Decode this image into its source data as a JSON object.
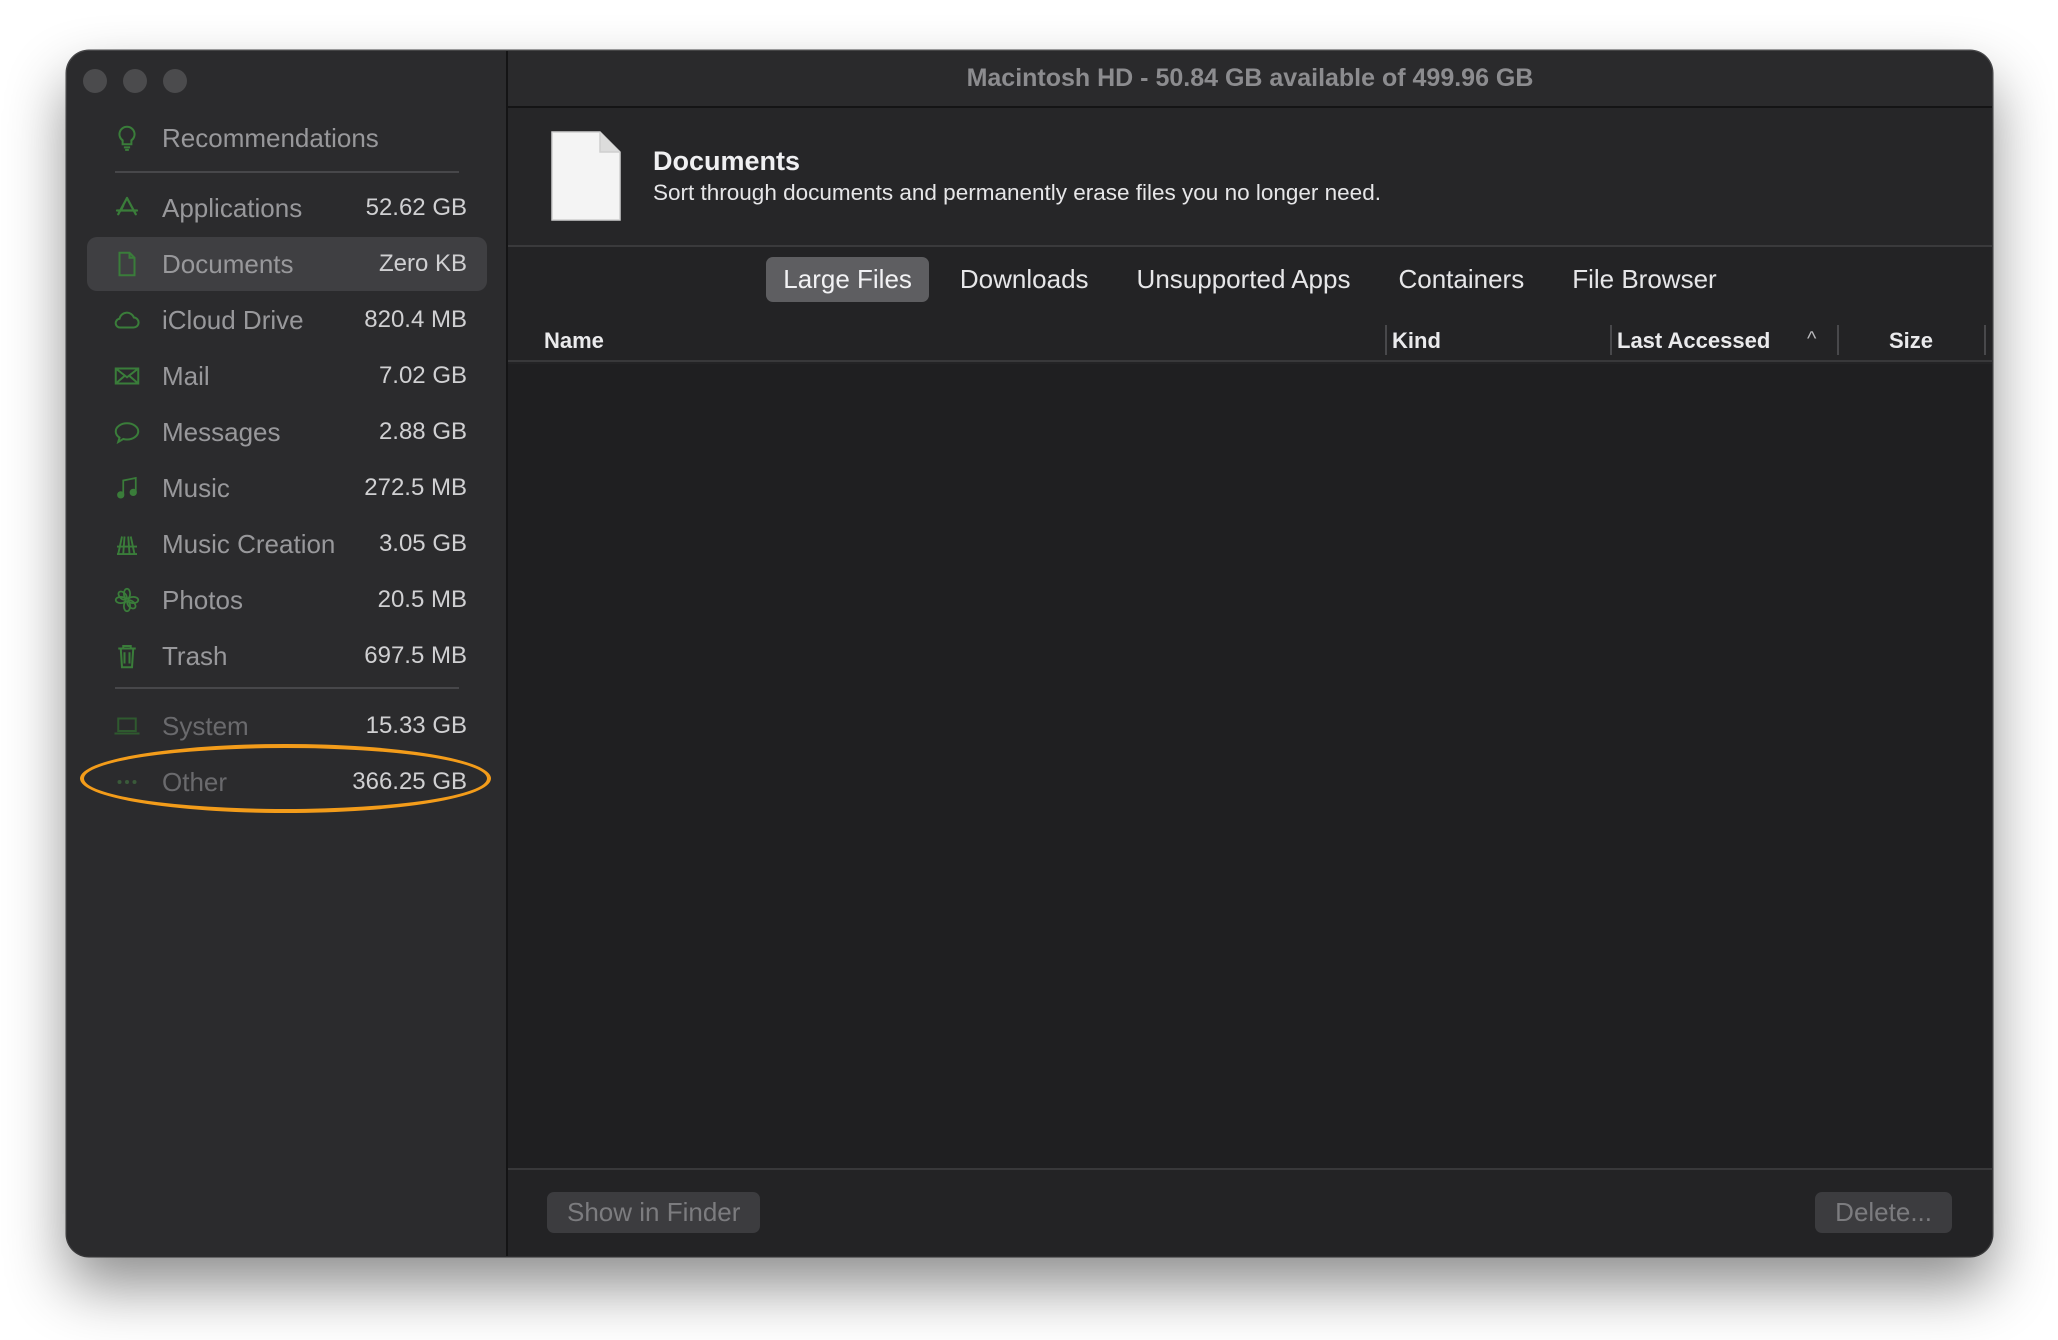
{
  "window": {
    "title": "Macintosh HD - 50.84 GB available of 499.96 GB"
  },
  "sidebar": {
    "recommendations": {
      "label": "Recommendations",
      "icon": "lightbulb-icon"
    },
    "items": [
      {
        "label": "Applications",
        "size": "52.62 GB",
        "icon": "app-store-icon"
      },
      {
        "label": "Documents",
        "size": "Zero KB",
        "icon": "document-icon",
        "selected": true
      },
      {
        "label": "iCloud Drive",
        "size": "820.4 MB",
        "icon": "cloud-icon"
      },
      {
        "label": "Mail",
        "size": "7.02 GB",
        "icon": "envelope-icon"
      },
      {
        "label": "Messages",
        "size": "2.88 GB",
        "icon": "speech-bubble-icon"
      },
      {
        "label": "Music",
        "size": "272.5 MB",
        "icon": "music-note-icon"
      },
      {
        "label": "Music Creation",
        "size": "3.05 GB",
        "icon": "guitar-icon"
      },
      {
        "label": "Photos",
        "size": "20.5 MB",
        "icon": "photos-flower-icon"
      },
      {
        "label": "Trash",
        "size": "697.5 MB",
        "icon": "trash-icon"
      }
    ],
    "system_items": [
      {
        "label": "System",
        "size": "15.33 GB",
        "icon": "laptop-icon"
      },
      {
        "label": "Other",
        "size": "366.25 GB",
        "icon": "ellipsis-icon"
      }
    ],
    "accent_color": "#3a7d3a",
    "highlight_color": "#f39c1a"
  },
  "header": {
    "title": "Documents",
    "description": "Sort through documents and permanently erase files you no longer need."
  },
  "tabs": [
    {
      "label": "Large Files",
      "active": true
    },
    {
      "label": "Downloads"
    },
    {
      "label": "Unsupported Apps"
    },
    {
      "label": "Containers"
    },
    {
      "label": "File Browser"
    }
  ],
  "columns": {
    "name": "Name",
    "kind": "Kind",
    "last_accessed": "Last Accessed",
    "size": "Size",
    "sort_indicator": "^"
  },
  "footer": {
    "show_in_finder": "Show in Finder",
    "delete": "Delete..."
  }
}
